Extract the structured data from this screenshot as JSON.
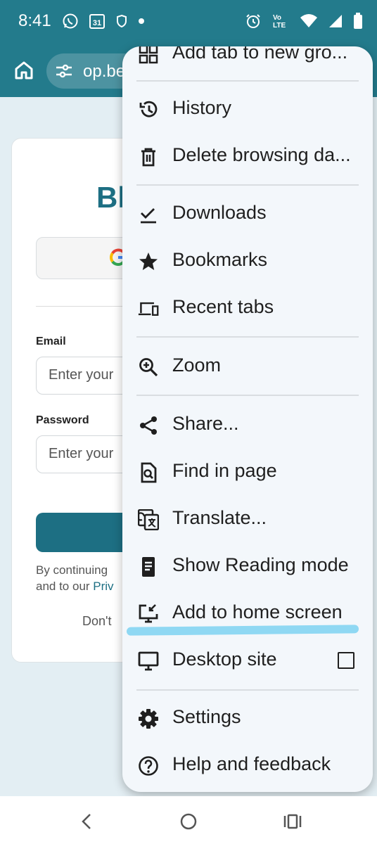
{
  "status_bar": {
    "time": "8:41",
    "calendar_day": "31",
    "network_label_top": "Vo",
    "network_label_bottom": "LTE",
    "icons_left": [
      "whatsapp-icon",
      "calendar-icon",
      "shield-icon",
      "dot-icon"
    ],
    "icons_right": [
      "alarm-icon",
      "volte-icon",
      "wifi-icon",
      "signal-icon",
      "battery-icon"
    ]
  },
  "toolbar": {
    "url_text": "op.be",
    "accent_color": "#237b8c"
  },
  "page": {
    "brand_text": "Bl",
    "email_label": "Email",
    "email_placeholder": "Enter your",
    "password_label": "Password",
    "password_placeholder": "Enter your",
    "terms_line1": "By continuing",
    "terms_line2_prefix": "and to our ",
    "terms_line2_link": "Priv",
    "dont_text": "Don't"
  },
  "menu": {
    "partial_top": "Add tab to new gro...",
    "items": [
      {
        "label": "History",
        "icon": "history-icon"
      },
      {
        "label": "Delete browsing da...",
        "icon": "trash-icon"
      },
      {
        "label": "Downloads",
        "icon": "download-check-icon"
      },
      {
        "label": "Bookmarks",
        "icon": "star-icon"
      },
      {
        "label": "Recent tabs",
        "icon": "devices-icon"
      },
      {
        "label": "Zoom",
        "icon": "zoom-in-icon"
      },
      {
        "label": "Share...",
        "icon": "share-icon"
      },
      {
        "label": "Find in page",
        "icon": "find-in-page-icon"
      },
      {
        "label": "Translate...",
        "icon": "translate-icon"
      },
      {
        "label": "Show Reading mode",
        "icon": "reading-mode-icon"
      },
      {
        "label": "Add to home screen",
        "icon": "add-to-home-icon"
      },
      {
        "label": "Desktop site",
        "icon": "desktop-icon",
        "checked": false
      },
      {
        "label": "Settings",
        "icon": "settings-icon"
      },
      {
        "label": "Help and feedback",
        "icon": "help-icon"
      }
    ],
    "highlighted_item": "Add to home screen",
    "highlight_color": "#8fd8f3"
  },
  "nav_bar": {
    "buttons": [
      "back-icon",
      "home-circle-icon",
      "recents-icon"
    ]
  }
}
